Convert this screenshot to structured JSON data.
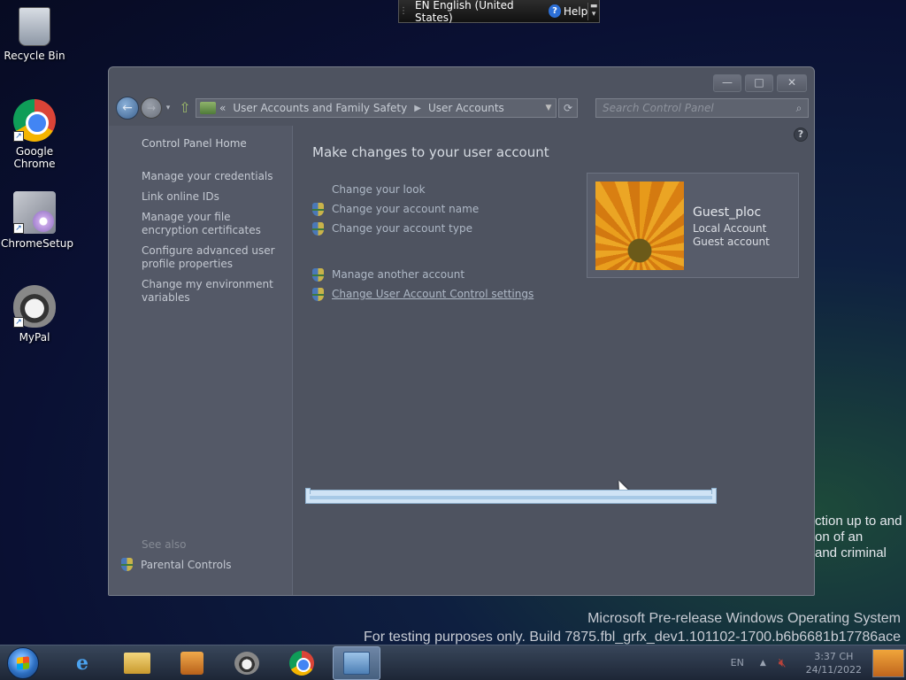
{
  "desktop": {
    "icons": [
      {
        "label": "Recycle Bin",
        "icon": "recycle-bin-icon"
      },
      {
        "label": "Google Chrome",
        "icon": "chrome-icon"
      },
      {
        "label": "ChromeSetup",
        "icon": "setup-icon"
      },
      {
        "label": "MyPal",
        "icon": "mypal-icon"
      }
    ],
    "partial_text": [
      "ction up to and",
      "on of an",
      "and criminal"
    ],
    "watermark": {
      "line1": "Microsoft Pre-release Windows Operating System",
      "line2": "For testing purposes only. Build 7875.fbl_grfx_dev1.101102-1700.b6b6681b17786ace"
    }
  },
  "language_bar": {
    "language": "EN English (United States)",
    "help": "Help"
  },
  "window": {
    "caption_buttons": {
      "minimize": "—",
      "maximize": "□",
      "close": "✕"
    },
    "address": {
      "chevron": "«",
      "crumbs": [
        "User Accounts and Family Safety",
        "User Accounts"
      ]
    },
    "search_placeholder": "Search Control Panel",
    "left_pane": {
      "home": "Control Panel Home",
      "tasks": [
        "Manage your credentials",
        "Link online IDs",
        "Manage your file encryption certificates",
        "Configure advanced user profile properties",
        "Change my environment variables"
      ],
      "see_also": "See also",
      "parental": "Parental Controls"
    },
    "content": {
      "heading": "Make changes to your user account",
      "links": [
        {
          "text": "Change your look",
          "shield": false
        },
        {
          "text": "Change your account name",
          "shield": true
        },
        {
          "text": "Change your account type",
          "shield": true
        }
      ],
      "links2": [
        {
          "text": "Manage another account",
          "shield": true
        },
        {
          "text": "Change User Account Control settings",
          "shield": true
        }
      ]
    },
    "account": {
      "name": "Guest_ploc",
      "type": "Local Account",
      "role": "Guest account"
    },
    "progress": {
      "fraction": 1.0
    }
  },
  "taskbar": {
    "apps": [
      "internet-explorer-icon",
      "file-explorer-icon",
      "media-player-icon",
      "mypal-icon",
      "chrome-icon",
      "control-panel-icon"
    ],
    "language": "EN",
    "time": "3:37 CH",
    "date": "24/11/2022"
  },
  "colors": {
    "link": "#aeb8c6",
    "window_bg": "#4e5360",
    "progress": "#cfe3f5"
  }
}
